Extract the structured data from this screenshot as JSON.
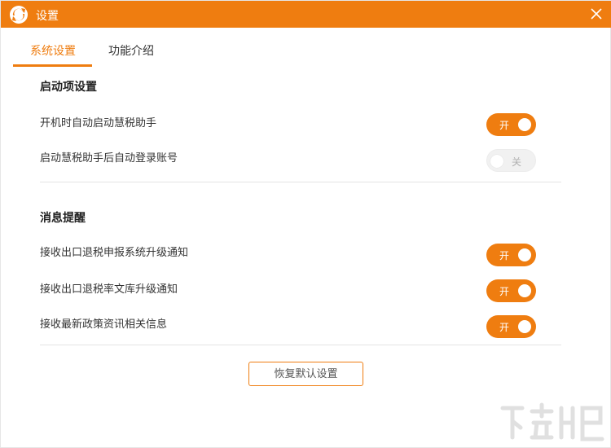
{
  "window": {
    "title": "设置"
  },
  "tabs": [
    {
      "label": "系统设置",
      "active": true
    },
    {
      "label": "功能介绍",
      "active": false
    }
  ],
  "sections": {
    "startup": {
      "title": "启动项设置",
      "items": [
        {
          "label": "开机时自动启动慧税助手",
          "state": "开",
          "on": true
        },
        {
          "label": "启动慧税助手后自动登录账号",
          "state": "关",
          "on": false
        }
      ]
    },
    "notify": {
      "title": "消息提醒",
      "items": [
        {
          "label": "接收出口退税申报系统升级通知",
          "state": "开",
          "on": true
        },
        {
          "label": "接收出口退税率文库升级通知",
          "state": "开",
          "on": true
        },
        {
          "label": "接收最新政策资讯相关信息",
          "state": "开",
          "on": true
        }
      ]
    }
  },
  "reset_button": "恢复默认设置",
  "colors": {
    "accent": "#ef7d10",
    "toggle_off": "#f1f1f1"
  },
  "icons": {
    "logo": "app-logo-icon",
    "close": "close-icon"
  }
}
